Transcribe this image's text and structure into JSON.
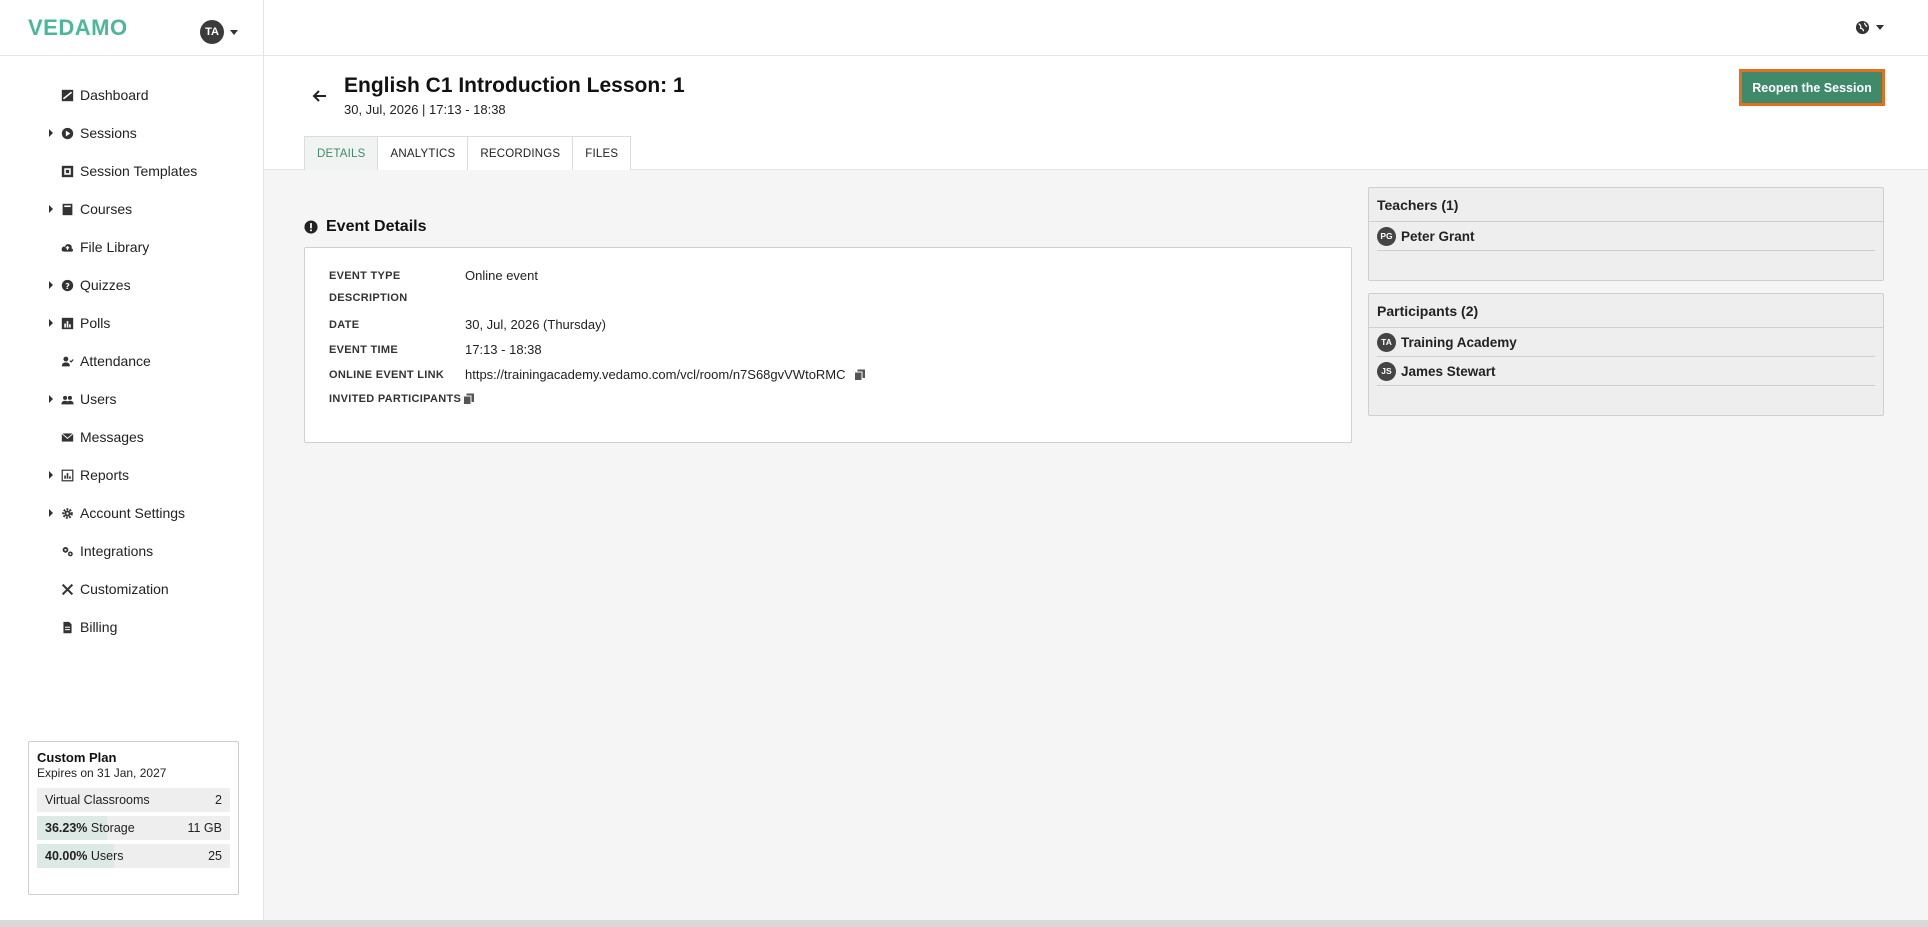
{
  "app": {
    "logo": "VEDAMO",
    "user_initials": "TA"
  },
  "nav": [
    {
      "label": "Dashboard",
      "icon": "dashboard-icon",
      "expandable": false
    },
    {
      "label": "Sessions",
      "icon": "play-circle-icon",
      "expandable": true
    },
    {
      "label": "Session Templates",
      "icon": "template-icon",
      "expandable": false
    },
    {
      "label": "Courses",
      "icon": "book-icon",
      "expandable": true
    },
    {
      "label": "File Library",
      "icon": "cloud-upload-icon",
      "expandable": false
    },
    {
      "label": "Quizzes",
      "icon": "question-circle-icon",
      "expandable": true
    },
    {
      "label": "Polls",
      "icon": "bar-chart-icon",
      "expandable": true
    },
    {
      "label": "Attendance",
      "icon": "user-check-icon",
      "expandable": false
    },
    {
      "label": "Users",
      "icon": "users-icon",
      "expandable": true
    },
    {
      "label": "Messages",
      "icon": "envelope-icon",
      "expandable": false
    },
    {
      "label": "Reports",
      "icon": "report-icon",
      "expandable": true
    },
    {
      "label": "Account Settings",
      "icon": "gear-icon",
      "expandable": true
    },
    {
      "label": "Integrations",
      "icon": "gears-icon",
      "expandable": false
    },
    {
      "label": "Customization",
      "icon": "tools-icon",
      "expandable": false
    },
    {
      "label": "Billing",
      "icon": "invoice-icon",
      "expandable": false
    }
  ],
  "plan": {
    "title": "Custom Plan",
    "expires": "Expires on 31 Jan, 2027",
    "rows": [
      {
        "pct": "",
        "label": "Virtual Classrooms",
        "value": "2"
      },
      {
        "pct": "36.23%",
        "label": "Storage",
        "value": "11 GB"
      },
      {
        "pct": "40.00%",
        "label": "Users",
        "value": "25"
      }
    ]
  },
  "header": {
    "title": "English C1 Introduction Lesson: 1",
    "subtitle": "30, Jul, 2026 | 17:13 - 18:38",
    "reopen_label": "Reopen the Session",
    "tabs": [
      "DETAILS",
      "ANALYTICS",
      "RECORDINGS",
      "FILES"
    ],
    "active_tab": "DETAILS"
  },
  "event": {
    "heading": "Event Details",
    "rows": [
      {
        "label": "EVENT TYPE",
        "value": "Online event"
      },
      {
        "label": "DESCRIPTION",
        "value": ""
      },
      {
        "label": "DATE",
        "value": "30, Jul, 2026 (Thursday)"
      },
      {
        "label": "EVENT TIME",
        "value": "17:13 - 18:38"
      },
      {
        "label": "ONLINE EVENT LINK",
        "value": "https://trainingacademy.vedamo.com/vcl/room/n7S68gvVWtoRMC"
      },
      {
        "label": "INVITED PARTICIPANTS",
        "value": ""
      }
    ]
  },
  "teachers": {
    "heading": "Teachers (1)",
    "people": [
      {
        "initials": "PG",
        "name": "Peter Grant"
      }
    ]
  },
  "participants": {
    "heading": "Participants (2)",
    "people": [
      {
        "initials": "TA",
        "name": "Training Academy"
      },
      {
        "initials": "JS",
        "name": "James Stewart"
      }
    ]
  },
  "colors": {
    "brand": "#4bb89a",
    "button": "#3f8a6a",
    "focus_outline": "#e2701f"
  }
}
